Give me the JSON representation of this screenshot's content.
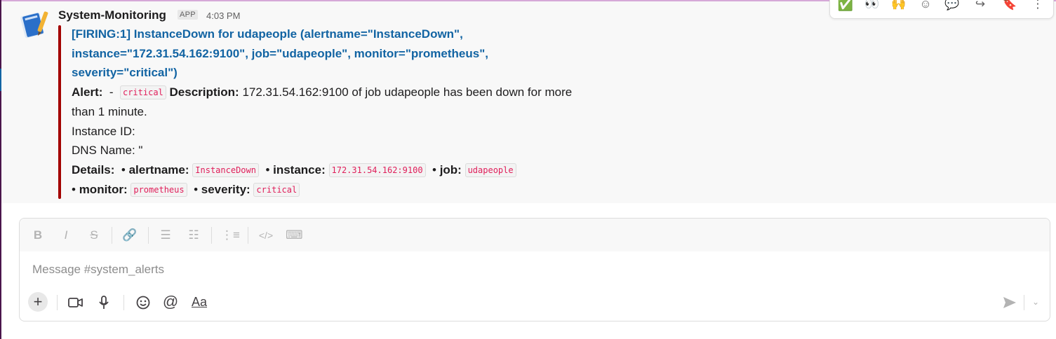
{
  "message": {
    "sender": "System-Monitoring",
    "badge": "APP",
    "timestamp": "4:03 PM",
    "attachment": {
      "accent_color": "#a30200",
      "title": "[FIRING:1] InstanceDown for udapeople (alertname=\"InstanceDown\", instance=\"172.31.54.162:9100\", job=\"udapeople\", monitor=\"prometheus\", severity=\"critical\")",
      "alert_label": "Alert:",
      "alert_dash": "-",
      "alert_severity": "critical",
      "description_label": "Description:",
      "description_text": "172.31.54.162:9100 of job udapeople has been down for more than 1 minute.",
      "instance_id_label": "Instance ID:",
      "dns_name_label": "DNS Name: \"",
      "details_label": "Details:",
      "details": [
        {
          "key": "alertname:",
          "value": "InstanceDown"
        },
        {
          "key": "instance:",
          "value": "172.31.54.162:9100"
        },
        {
          "key": "job:",
          "value": "udapeople"
        },
        {
          "key": "monitor:",
          "value": "prometheus"
        },
        {
          "key": "severity:",
          "value": "critical"
        }
      ]
    }
  },
  "actions": [
    "check-mark-emoji",
    "eyes-emoji",
    "raised-hands-emoji",
    "add-reaction-icon",
    "reply-in-thread-icon",
    "share-icon",
    "bookmark-icon",
    "more-actions-icon"
  ],
  "composer": {
    "placeholder": "Message #system_alerts",
    "format_buttons": [
      "bold",
      "italic",
      "strikethrough",
      "link",
      "ordered-list",
      "bulleted-list",
      "blockquote",
      "code",
      "code-block"
    ],
    "tools": [
      "attach",
      "video-clip",
      "audio-clip",
      "emoji",
      "mention",
      "formatting"
    ]
  }
}
